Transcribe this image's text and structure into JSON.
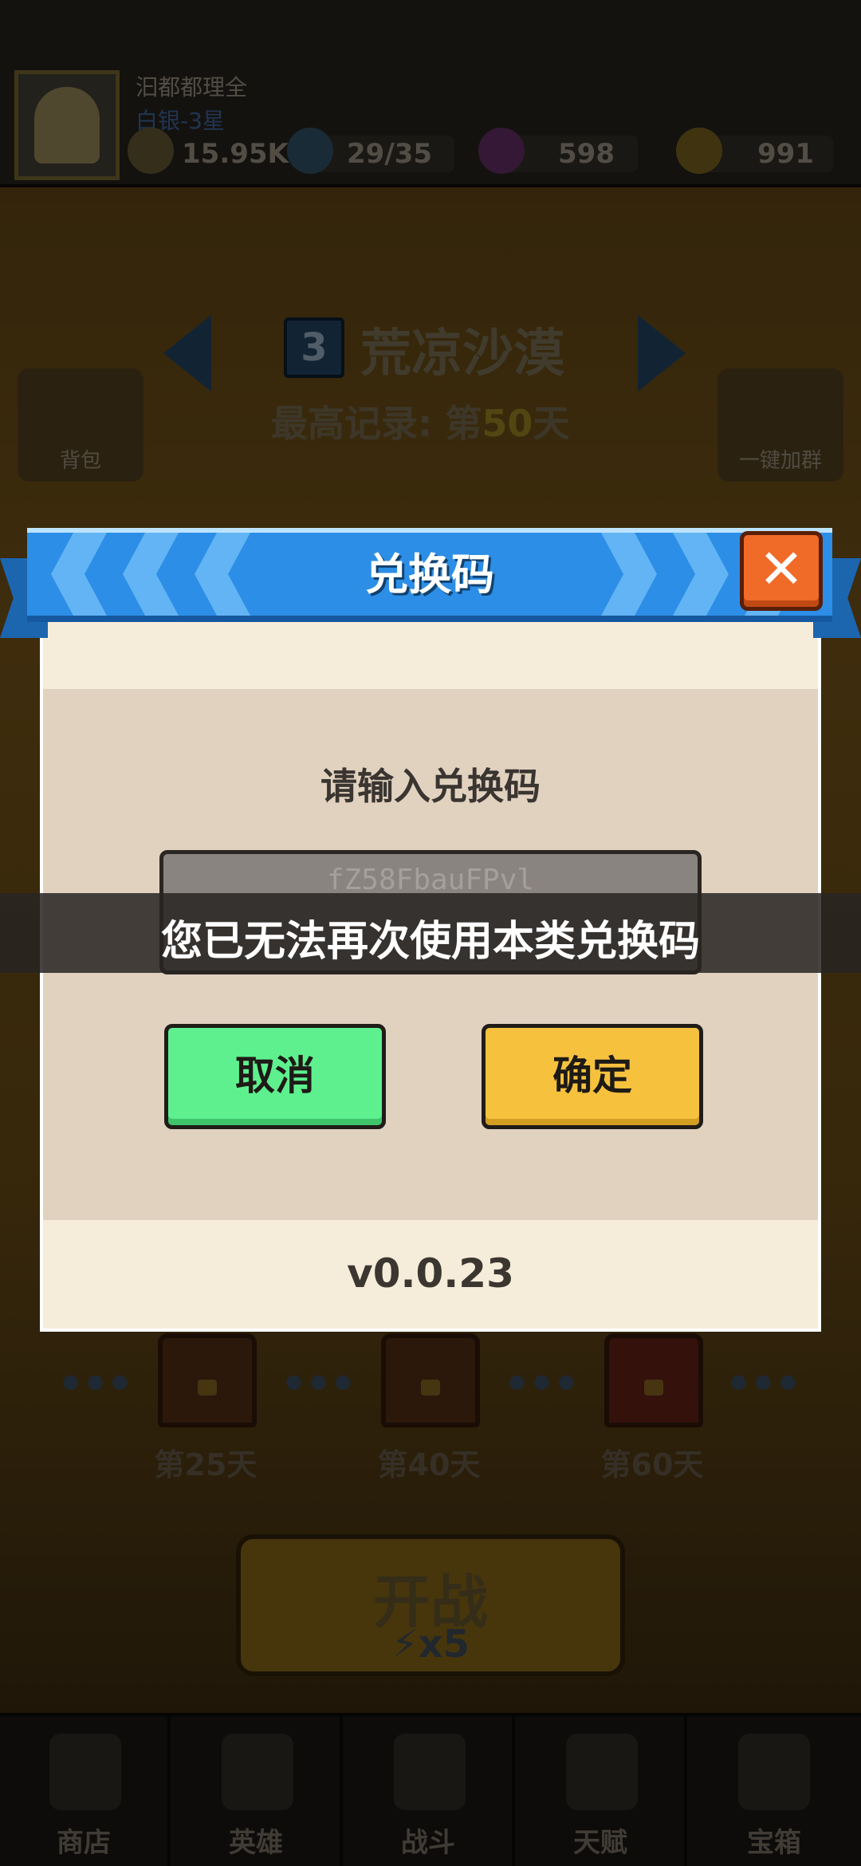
{
  "player": {
    "name": "汩都都理全",
    "rank": "白银-3星",
    "power": "15.95K",
    "energy": "29/35",
    "gems": "598",
    "coins": "991"
  },
  "chapter": {
    "number": "3",
    "title": "荒凉沙漠",
    "record_prefix": "最高记录: 第",
    "record_day": "50",
    "record_suffix": "天"
  },
  "side_buttons": {
    "bag": "背包",
    "join_group": "一键加群"
  },
  "chests": [
    {
      "label": "第25天"
    },
    {
      "label": "第40天"
    },
    {
      "label": "第60天"
    }
  ],
  "start_button": {
    "label": "开战",
    "cost": "x5"
  },
  "bottom_nav": [
    {
      "label": "商店"
    },
    {
      "label": "英雄"
    },
    {
      "label": "战斗"
    },
    {
      "label": "天赋"
    },
    {
      "label": "宝箱"
    }
  ],
  "dialog": {
    "title": "兑换码",
    "close_glyph": "✕",
    "prompt": "请输入兑换码",
    "input_value": "fZ58FbauFPvl",
    "cancel_label": "取消",
    "confirm_label": "确定",
    "version": "v0.0.23"
  },
  "toast": {
    "message": "您已无法再次使用本类兑换码"
  },
  "colors": {
    "ribbon": "#2c8ee6",
    "close": "#f06a28",
    "cancel": "#5ef08e",
    "confirm": "#f6c23e"
  }
}
